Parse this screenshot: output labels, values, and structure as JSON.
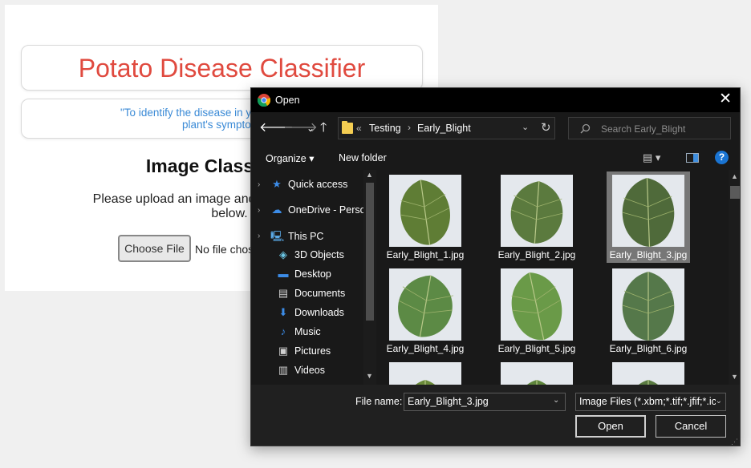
{
  "page": {
    "title": "Potato Disease Classifier",
    "quote_line1": "\"To identify the disease in your potato plant, p",
    "quote_line2": "plant's symptomatic",
    "heading": "Image Class",
    "instruction_line1": "Please upload an image and see the cla",
    "instruction_line2": "below.",
    "choose_file": "Choose File",
    "no_file": "No file chos"
  },
  "dialog": {
    "title": "Open",
    "close": "✕",
    "nav": {
      "back": "🡐",
      "forward": "🡒",
      "dropdown": "⌄",
      "up": "🡑"
    },
    "address": {
      "chevron": "«",
      "crumbs": [
        "Testing",
        "Early_Blight"
      ],
      "sep": "›",
      "drop": "⌄",
      "refresh": "↻"
    },
    "search_placeholder": "Search Early_Blight",
    "toolbar": {
      "organize": "Organize ▾",
      "new_folder": "New folder",
      "view_icon": "▤ ▾",
      "help": "?"
    },
    "sidebar": [
      {
        "label": "Quick access",
        "icon": "star-icon",
        "glyph": "★",
        "color": "#3c8ce7"
      },
      {
        "label": "OneDrive - Person",
        "icon": "cloud-icon",
        "glyph": "☁",
        "color": "#3c8ce7"
      },
      {
        "label": "This PC",
        "icon": "computer-icon",
        "glyph": "🖳",
        "color": "#5aa9e6"
      },
      {
        "label": "3D Objects",
        "icon": "cube-icon",
        "glyph": "◈",
        "color": "#6cc7e6"
      },
      {
        "label": "Desktop",
        "icon": "desktop-icon",
        "glyph": "▬",
        "color": "#3c8ce7"
      },
      {
        "label": "Documents",
        "icon": "document-icon",
        "glyph": "▤",
        "color": "#d0d0d0"
      },
      {
        "label": "Downloads",
        "icon": "download-icon",
        "glyph": "⬇",
        "color": "#3c8ce7"
      },
      {
        "label": "Music",
        "icon": "music-icon",
        "glyph": "♪",
        "color": "#3c8ce7"
      },
      {
        "label": "Pictures",
        "icon": "pictures-icon",
        "glyph": "▣",
        "color": "#d0d0d0"
      },
      {
        "label": "Videos",
        "icon": "video-icon",
        "glyph": "▥",
        "color": "#d0d0d0"
      }
    ],
    "files": [
      "Early_Blight_1.jpg",
      "Early_Blight_2.jpg",
      "Early_Blight_3.jpg",
      "Early_Blight_4.jpg",
      "Early_Blight_5.jpg",
      "Early_Blight_6.jpg",
      "",
      "",
      ""
    ],
    "selected_file_index": 2,
    "file_name_label": "File name:",
    "file_name_value": "Early_Blight_3.jpg",
    "filter_value": "Image Files (*.xbm;*.tif;*.jfif;*.ic",
    "open_button": "Open",
    "cancel_button": "Cancel"
  },
  "colors": {
    "title_red": "#e04a3f",
    "quote_blue": "#3a8ad6",
    "leaf_colors": [
      "#5f7d35",
      "#5b7a3e",
      "#4f6a3a",
      "#5c8a45",
      "#6a9a48",
      "#55784a",
      "#6a8a3a",
      "#5e853c",
      "#5a7b42"
    ]
  }
}
